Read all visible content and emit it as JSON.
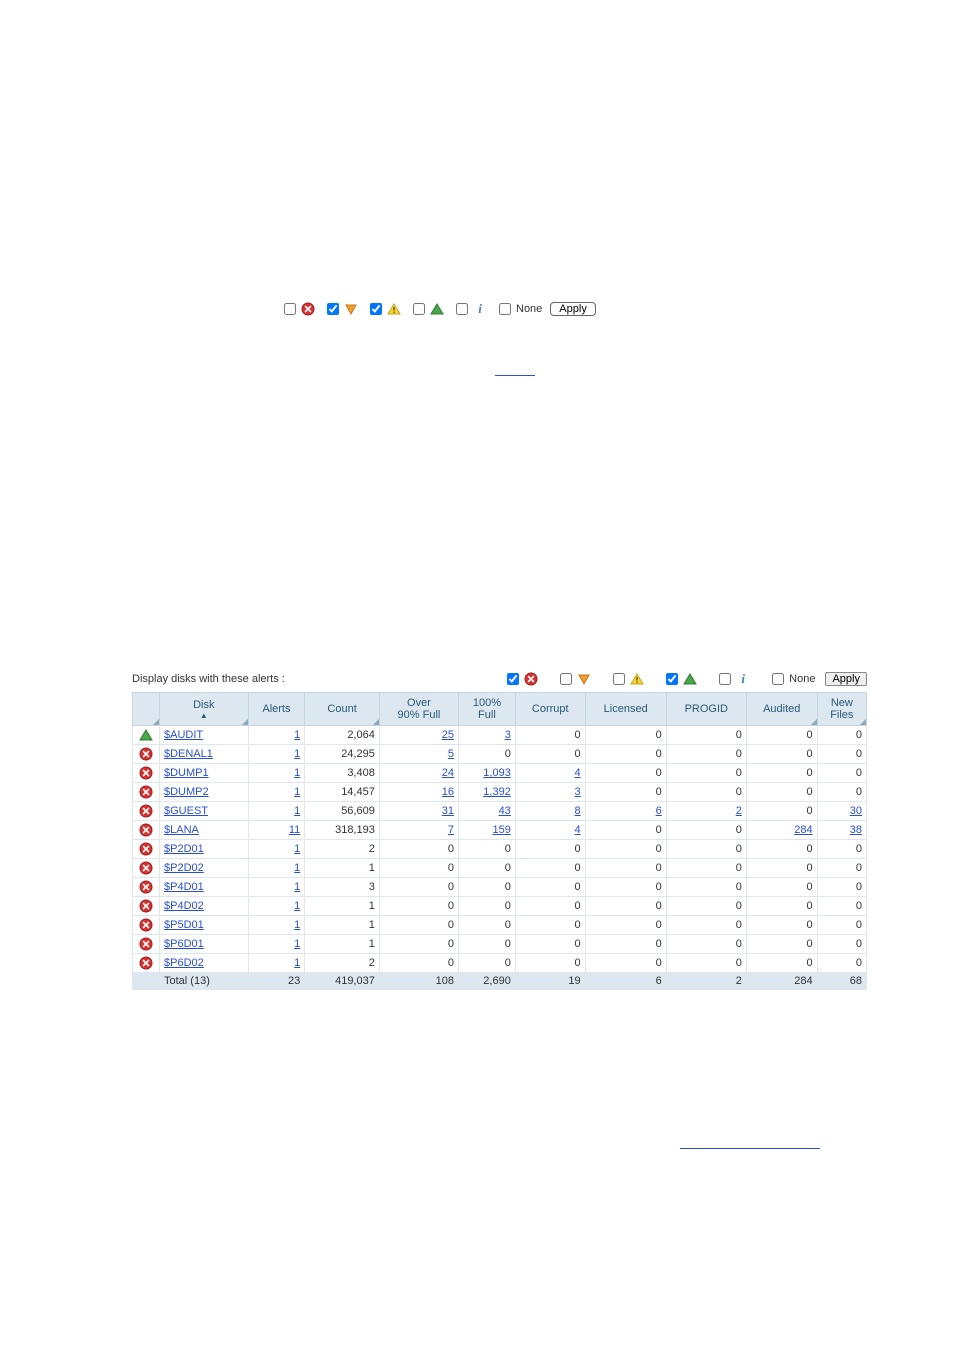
{
  "topFilter": {
    "options": [
      {
        "name": "error",
        "checked": false,
        "icon": "error"
      },
      {
        "name": "down",
        "checked": true,
        "icon": "down-orange"
      },
      {
        "name": "warn",
        "checked": true,
        "icon": "warn-yellow"
      },
      {
        "name": "up",
        "checked": false,
        "icon": "up-green"
      },
      {
        "name": "info",
        "checked": false,
        "icon": "info"
      },
      {
        "name": "none",
        "checked": false,
        "label": "None"
      }
    ],
    "applyLabel": "Apply"
  },
  "mainFilter": {
    "label": "Display disks with these alerts :",
    "options": [
      {
        "name": "error",
        "checked": true,
        "icon": "error"
      },
      {
        "name": "down",
        "checked": false,
        "icon": "down-orange"
      },
      {
        "name": "warn",
        "checked": false,
        "icon": "warn-yellow"
      },
      {
        "name": "up",
        "checked": true,
        "icon": "up-green"
      },
      {
        "name": "info",
        "checked": false,
        "icon": "info"
      },
      {
        "name": "none",
        "checked": false,
        "label": "None"
      }
    ],
    "applyLabel": "Apply"
  },
  "columns": [
    {
      "key": "icon",
      "label": "",
      "corner": true
    },
    {
      "key": "disk",
      "label": "Disk",
      "corner": true,
      "sorted": "asc"
    },
    {
      "key": "alerts",
      "label": "Alerts",
      "corner": false
    },
    {
      "key": "count",
      "label": "Count",
      "corner": true
    },
    {
      "key": "over90",
      "label": "Over 90% Full",
      "corner": false
    },
    {
      "key": "full100",
      "label": "100% Full",
      "corner": false
    },
    {
      "key": "corrupt",
      "label": "Corrupt",
      "corner": false
    },
    {
      "key": "licensed",
      "label": "Licensed",
      "corner": false
    },
    {
      "key": "progid",
      "label": "PROGID",
      "corner": false
    },
    {
      "key": "audited",
      "label": "Audited",
      "corner": true
    },
    {
      "key": "newfiles",
      "label": "New Files",
      "corner": true
    }
  ],
  "rows": [
    {
      "icon": "up-green",
      "disk": "$AUDIT",
      "alerts": {
        "v": "1",
        "link": true
      },
      "count": "2,064",
      "over90": {
        "v": "25",
        "link": true
      },
      "full100": {
        "v": "3",
        "link": true
      },
      "corrupt": {
        "v": "0"
      },
      "licensed": {
        "v": "0"
      },
      "progid": {
        "v": "0"
      },
      "audited": {
        "v": "0"
      },
      "newfiles": {
        "v": "0"
      }
    },
    {
      "icon": "error",
      "disk": "$DENAL1",
      "alerts": {
        "v": "1",
        "link": true
      },
      "count": "24,295",
      "over90": {
        "v": "5",
        "link": true
      },
      "full100": {
        "v": "0"
      },
      "corrupt": {
        "v": "0"
      },
      "licensed": {
        "v": "0"
      },
      "progid": {
        "v": "0"
      },
      "audited": {
        "v": "0"
      },
      "newfiles": {
        "v": "0"
      }
    },
    {
      "icon": "error",
      "disk": "$DUMP1",
      "alerts": {
        "v": "1",
        "link": true
      },
      "count": "3,408",
      "over90": {
        "v": "24",
        "link": true
      },
      "full100": {
        "v": "1,093",
        "link": true
      },
      "corrupt": {
        "v": "4",
        "link": true
      },
      "licensed": {
        "v": "0"
      },
      "progid": {
        "v": "0"
      },
      "audited": {
        "v": "0"
      },
      "newfiles": {
        "v": "0"
      }
    },
    {
      "icon": "error",
      "disk": "$DUMP2",
      "alerts": {
        "v": "1",
        "link": true
      },
      "count": "14,457",
      "over90": {
        "v": "16",
        "link": true
      },
      "full100": {
        "v": "1,392",
        "link": true
      },
      "corrupt": {
        "v": "3",
        "link": true
      },
      "licensed": {
        "v": "0"
      },
      "progid": {
        "v": "0"
      },
      "audited": {
        "v": "0"
      },
      "newfiles": {
        "v": "0"
      }
    },
    {
      "icon": "error",
      "disk": "$GUEST",
      "alerts": {
        "v": "1",
        "link": true
      },
      "count": "56,609",
      "over90": {
        "v": "31",
        "link": true
      },
      "full100": {
        "v": "43",
        "link": true
      },
      "corrupt": {
        "v": "8",
        "link": true
      },
      "licensed": {
        "v": "6",
        "link": true
      },
      "progid": {
        "v": "2",
        "link": true
      },
      "audited": {
        "v": "0"
      },
      "newfiles": {
        "v": "30",
        "link": true
      }
    },
    {
      "icon": "error",
      "disk": "$LANA",
      "alerts": {
        "v": "11",
        "link": true
      },
      "count": "318,193",
      "over90": {
        "v": "7",
        "link": true
      },
      "full100": {
        "v": "159",
        "link": true
      },
      "corrupt": {
        "v": "4",
        "link": true
      },
      "licensed": {
        "v": "0"
      },
      "progid": {
        "v": "0"
      },
      "audited": {
        "v": "284",
        "link": true
      },
      "newfiles": {
        "v": "38",
        "link": true
      }
    },
    {
      "icon": "error",
      "disk": "$P2D01",
      "alerts": {
        "v": "1",
        "link": true
      },
      "count": "2",
      "over90": {
        "v": "0"
      },
      "full100": {
        "v": "0"
      },
      "corrupt": {
        "v": "0"
      },
      "licensed": {
        "v": "0"
      },
      "progid": {
        "v": "0"
      },
      "audited": {
        "v": "0"
      },
      "newfiles": {
        "v": "0"
      }
    },
    {
      "icon": "error",
      "disk": "$P2D02",
      "alerts": {
        "v": "1",
        "link": true
      },
      "count": "1",
      "over90": {
        "v": "0"
      },
      "full100": {
        "v": "0"
      },
      "corrupt": {
        "v": "0"
      },
      "licensed": {
        "v": "0"
      },
      "progid": {
        "v": "0"
      },
      "audited": {
        "v": "0"
      },
      "newfiles": {
        "v": "0"
      }
    },
    {
      "icon": "error",
      "disk": "$P4D01",
      "alerts": {
        "v": "1",
        "link": true
      },
      "count": "3",
      "over90": {
        "v": "0"
      },
      "full100": {
        "v": "0"
      },
      "corrupt": {
        "v": "0"
      },
      "licensed": {
        "v": "0"
      },
      "progid": {
        "v": "0"
      },
      "audited": {
        "v": "0"
      },
      "newfiles": {
        "v": "0"
      }
    },
    {
      "icon": "error",
      "disk": "$P4D02",
      "alerts": {
        "v": "1",
        "link": true
      },
      "count": "1",
      "over90": {
        "v": "0"
      },
      "full100": {
        "v": "0"
      },
      "corrupt": {
        "v": "0"
      },
      "licensed": {
        "v": "0"
      },
      "progid": {
        "v": "0"
      },
      "audited": {
        "v": "0"
      },
      "newfiles": {
        "v": "0"
      }
    },
    {
      "icon": "error",
      "disk": "$P5D01",
      "alerts": {
        "v": "1",
        "link": true
      },
      "count": "1",
      "over90": {
        "v": "0"
      },
      "full100": {
        "v": "0"
      },
      "corrupt": {
        "v": "0"
      },
      "licensed": {
        "v": "0"
      },
      "progid": {
        "v": "0"
      },
      "audited": {
        "v": "0"
      },
      "newfiles": {
        "v": "0"
      }
    },
    {
      "icon": "error",
      "disk": "$P6D01",
      "alerts": {
        "v": "1",
        "link": true
      },
      "count": "1",
      "over90": {
        "v": "0"
      },
      "full100": {
        "v": "0"
      },
      "corrupt": {
        "v": "0"
      },
      "licensed": {
        "v": "0"
      },
      "progid": {
        "v": "0"
      },
      "audited": {
        "v": "0"
      },
      "newfiles": {
        "v": "0"
      }
    },
    {
      "icon": "error",
      "disk": "$P6D02",
      "alerts": {
        "v": "1",
        "link": true
      },
      "count": "2",
      "over90": {
        "v": "0"
      },
      "full100": {
        "v": "0"
      },
      "corrupt": {
        "v": "0"
      },
      "licensed": {
        "v": "0"
      },
      "progid": {
        "v": "0"
      },
      "audited": {
        "v": "0"
      },
      "newfiles": {
        "v": "0"
      }
    }
  ],
  "total": {
    "label": "Total (13)",
    "alerts": "23",
    "count": "419,037",
    "over90": "108",
    "full100": "2,690",
    "corrupt": "19",
    "licensed": "6",
    "progid": "2",
    "audited": "284",
    "newfiles": "68"
  }
}
